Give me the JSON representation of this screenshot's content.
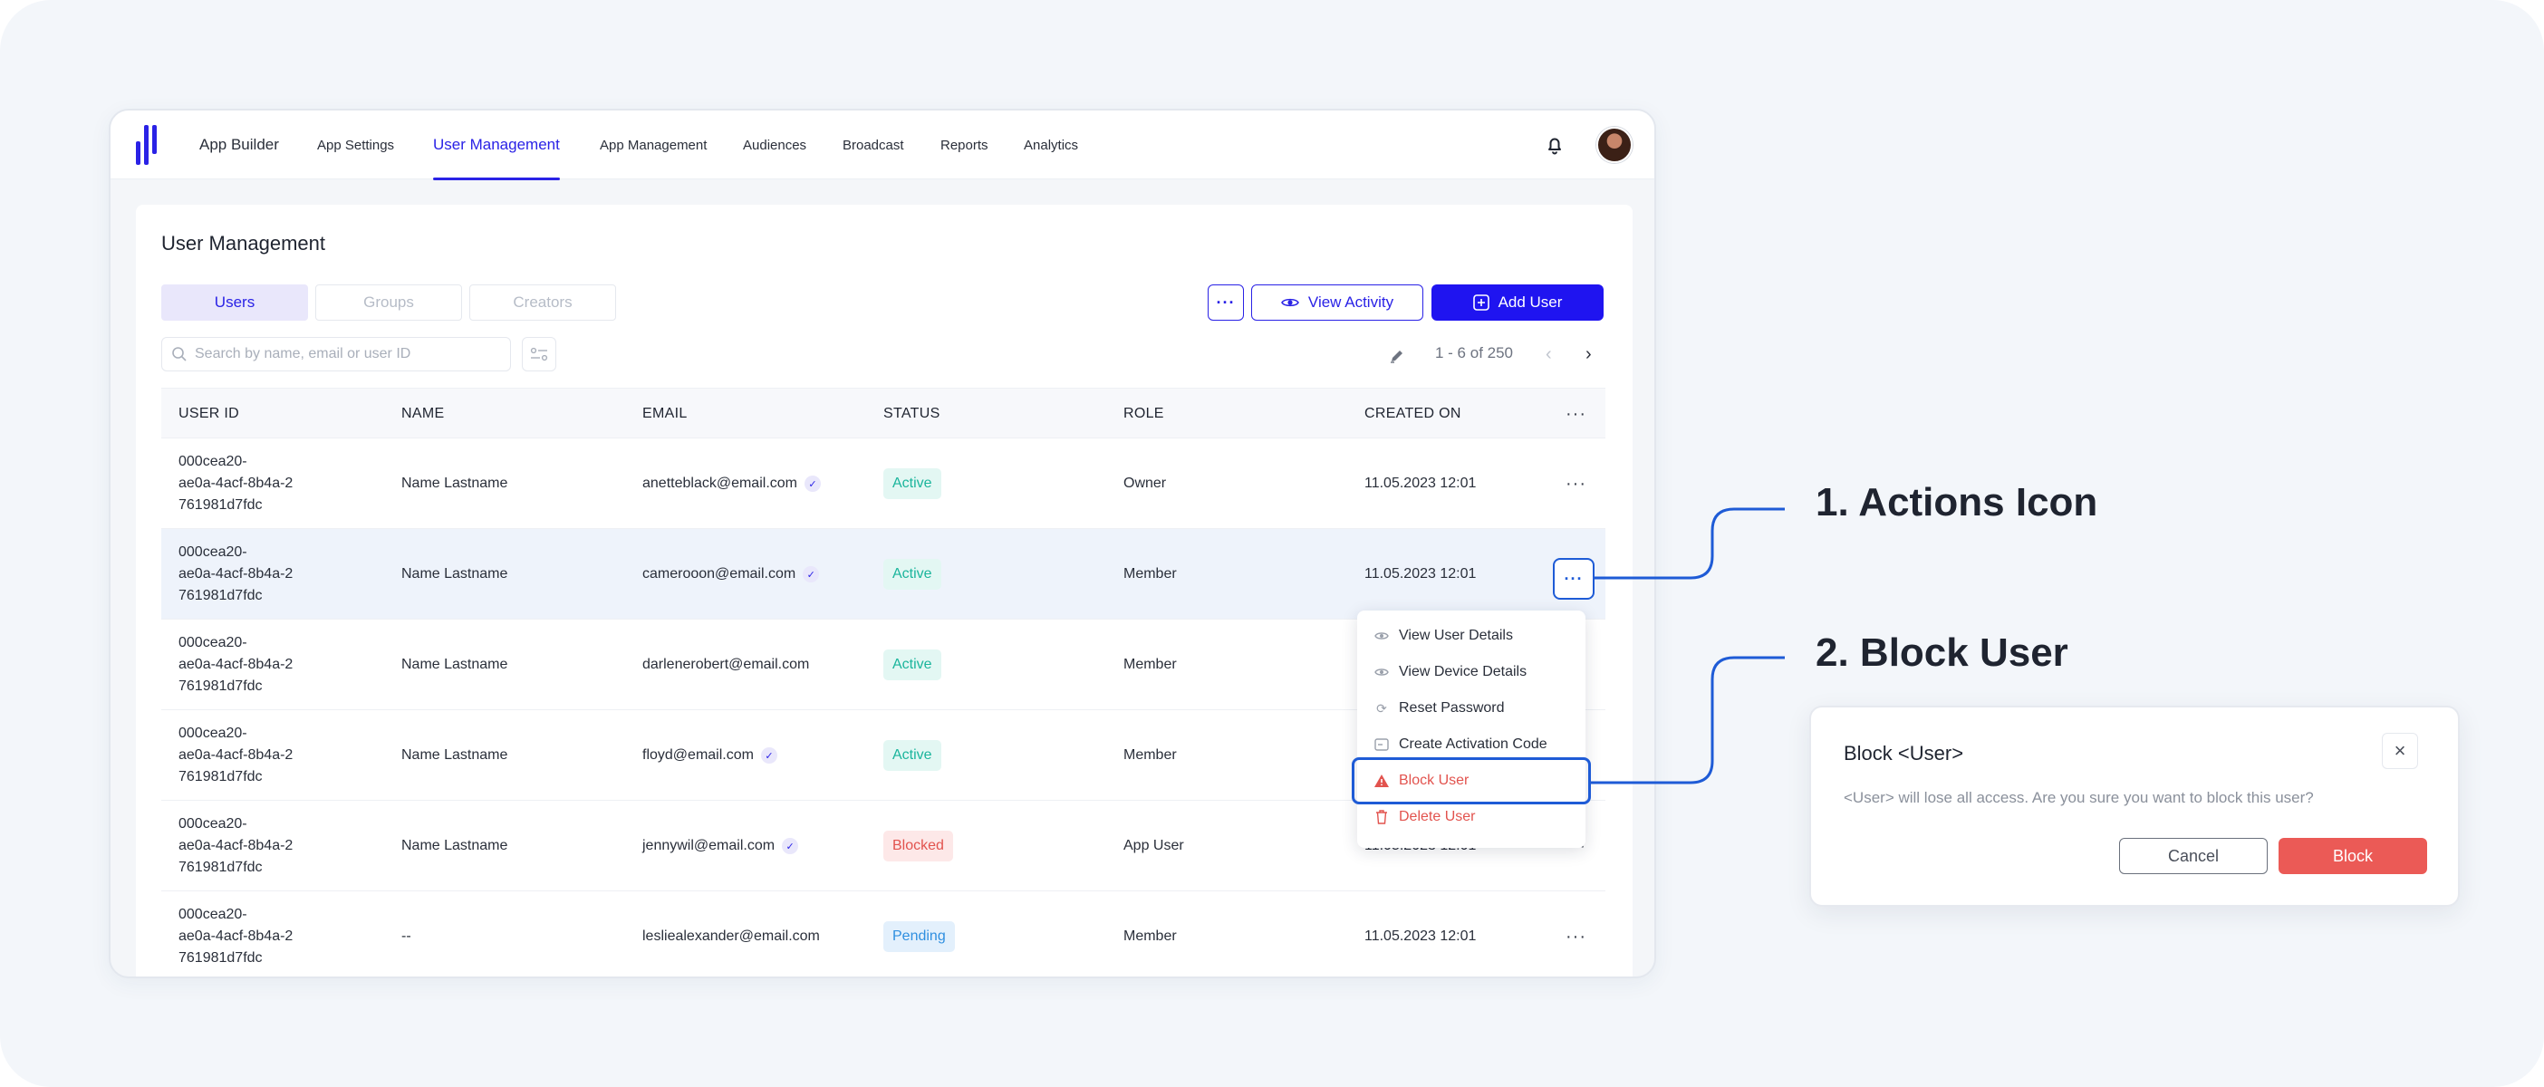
{
  "nav": {
    "items": [
      {
        "label": "App Builder"
      },
      {
        "label": "App Settings"
      },
      {
        "label": "User Management"
      },
      {
        "label": "App Management"
      },
      {
        "label": "Audiences"
      },
      {
        "label": "Broadcast"
      },
      {
        "label": "Reports"
      },
      {
        "label": "Analytics"
      }
    ],
    "active": "User Management"
  },
  "page": {
    "title": "User Management",
    "tabs": [
      "Users",
      "Groups",
      "Creators"
    ],
    "view_activity_label": "View Activity",
    "add_user_label": "Add User",
    "search_placeholder": "Search by name, email or user ID",
    "pagination": "1 - 6 of 250"
  },
  "table": {
    "headers": [
      "USER ID",
      "NAME",
      "EMAIL",
      "STATUS",
      "ROLE",
      "CREATED ON"
    ],
    "rows": [
      {
        "id": "000cea20-\nae0a-4acf-8b4a-2\n761981d7fdc",
        "name": "Name Lastname",
        "email": "anetteblack@email.com",
        "verified": true,
        "status": "Active",
        "role": "Owner",
        "created": "11.05.2023 12:01"
      },
      {
        "id": "000cea20-\nae0a-4acf-8b4a-2\n761981d7fdc",
        "name": "Name Lastname",
        "email": "camerooon@email.com",
        "verified": true,
        "status": "Active",
        "role": "Member",
        "created": "11.05.2023 12:01"
      },
      {
        "id": "000cea20-\nae0a-4acf-8b4a-2\n761981d7fdc",
        "name": "Name Lastname",
        "email": "darlenerobert@email.com",
        "verified": false,
        "status": "Active",
        "role": "Member",
        "created": ""
      },
      {
        "id": "000cea20-\nae0a-4acf-8b4a-2\n761981d7fdc",
        "name": "Name Lastname",
        "email": "floyd@email.com",
        "verified": true,
        "status": "Active",
        "role": "Member",
        "created": ""
      },
      {
        "id": "000cea20-\nae0a-4acf-8b4a-2\n761981d7fdc",
        "name": "Name Lastname",
        "email": "jennywil@email.com",
        "verified": true,
        "status": "Blocked",
        "role": "App User",
        "created": "11.05.2023 12:01"
      },
      {
        "id": "000cea20-\nae0a-4acf-8b4a-2\n761981d7fdc",
        "name": "--",
        "email": "lesliealexander@email.com",
        "verified": false,
        "status": "Pending",
        "role": "Member",
        "created": "11.05.2023 12:01"
      }
    ]
  },
  "menu": {
    "items": [
      {
        "label": "View User Details",
        "icon": "eye-icon"
      },
      {
        "label": "View Device Details",
        "icon": "eye-icon"
      },
      {
        "label": "Reset Password",
        "icon": "refresh-icon"
      },
      {
        "label": "Create Activation Code",
        "icon": "code-icon"
      },
      {
        "label": "Block User",
        "icon": "warning-icon"
      },
      {
        "label": "Delete User",
        "icon": "trash-icon"
      }
    ]
  },
  "callouts": {
    "one": "1. Actions Icon",
    "two": "2. Block User"
  },
  "dialog": {
    "title": "Block <User>",
    "message": "<User> will lose all access. Are you sure you want to block this user?",
    "cancel_label": "Cancel",
    "block_label": "Block"
  },
  "colors": {
    "accent": "#2a22e6",
    "primary_button": "#1f14f0",
    "highlight": "#1e5bd6",
    "danger": "#eb5a56",
    "active_badge": "#1bb59c",
    "blocked_badge": "#e2534e",
    "pending_badge": "#2f8fe0"
  }
}
